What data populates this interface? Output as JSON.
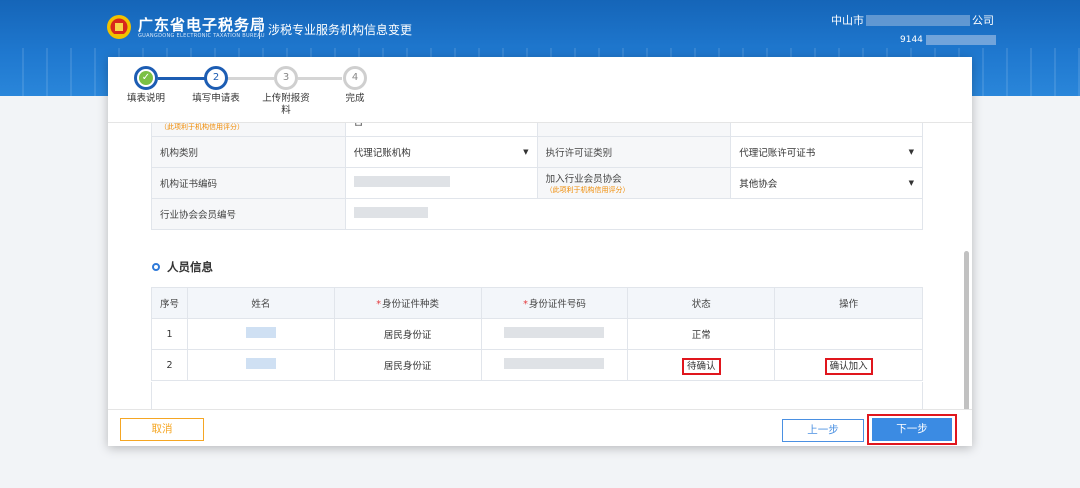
{
  "header": {
    "brand_cn": "广东省电子税务局",
    "brand_en": "GUANGDONG ELECTRONIC TAXATION BUREAU",
    "page_title": "涉税专业服务机构信息变更",
    "company_prefix": "中山市",
    "company_suffix": "公司",
    "taxid_prefix": "9144"
  },
  "steps": [
    {
      "num": "✓",
      "label": "填表说明",
      "state": "done"
    },
    {
      "num": "2",
      "label": "填写申请表",
      "state": "active"
    },
    {
      "num": "3",
      "label": "上传附报资料",
      "state": "todo"
    },
    {
      "num": "4",
      "label": "完成",
      "state": "todo"
    }
  ],
  "form": {
    "partial_hint": "（此项利于机构信用评分）",
    "partial_value": "否",
    "row1": {
      "label1": "机构类别",
      "value1": "代理记账机构",
      "label2": "执行许可证类别",
      "value2": "代理记账许可证书"
    },
    "row2": {
      "label1": "机构证书编码",
      "label2": "加入行业会员协会",
      "hint2": "（此项利于机构信用评分）",
      "value2": "其他协会"
    },
    "row3": {
      "label1": "行业协会会员编号"
    }
  },
  "personnel": {
    "section_title": "人员信息",
    "headers": {
      "seq": "序号",
      "name": "姓名",
      "id_type": "身份证件种类",
      "id_no": "身份证件号码",
      "status": "状态",
      "op": "操作"
    },
    "rows": [
      {
        "seq": "1",
        "id_type": "居民身份证",
        "status": "正常",
        "op": ""
      },
      {
        "seq": "2",
        "id_type": "居民身份证",
        "status": "待确认",
        "op": "确认加入"
      }
    ]
  },
  "footer": {
    "cancel": "取消",
    "prev": "上一步",
    "next": "下一步"
  },
  "colors": {
    "primary": "#1d5db3",
    "accent_green": "#7bc043",
    "highlight_red": "#e0161d",
    "cancel_orange": "#f5a623"
  }
}
